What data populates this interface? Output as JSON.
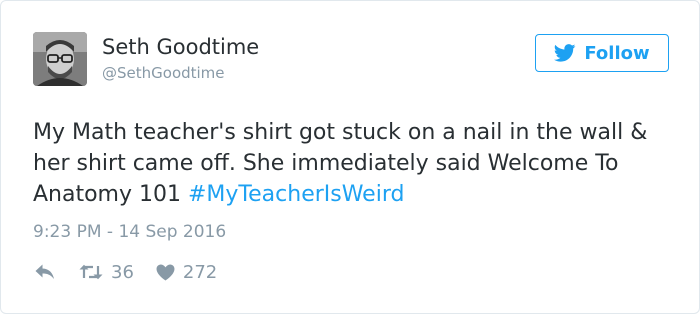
{
  "author": {
    "name": "Seth Goodtime",
    "handle": "@SethGoodtime",
    "avatar_icon": "profile-photo"
  },
  "follow_button": {
    "label": "Follow",
    "icon": "twitter-bird-icon",
    "color": "#1da1f2"
  },
  "tweet": {
    "text_before_hashtag": "My Math teacher's shirt got stuck on a nail in the wall & her shirt came off. She immediately said Welcome To Anatomy 101 ",
    "hashtag": "#MyTeacherIsWeird",
    "hashtag_color": "#1da1f2"
  },
  "timestamp": "9:23 PM - 14 Sep 2016",
  "actions": {
    "reply_icon": "reply-icon",
    "retweet_icon": "retweet-icon",
    "retweet_count": "36",
    "like_icon": "heart-icon",
    "like_count": "272",
    "icon_color": "#8899a6"
  }
}
